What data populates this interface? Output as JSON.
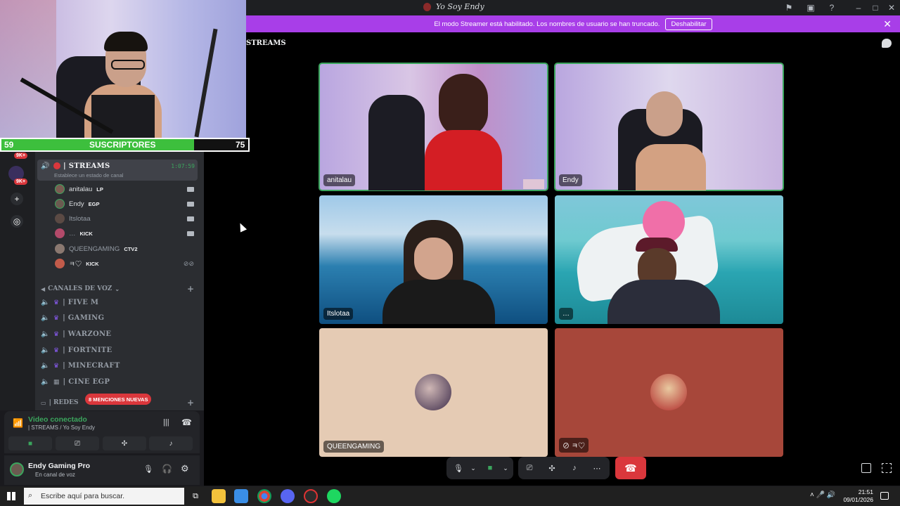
{
  "window": {
    "title": "Yo Soy Endy"
  },
  "banner": {
    "text": "El modo Streamer está habilitado. Los nombres de usuario se han truncado.",
    "button": "Deshabilitar"
  },
  "channel_header": "STREAMS",
  "overlay": {
    "sub_left": "59",
    "sub_label": "SUSCRIPTORES",
    "sub_right": "75",
    "sub_progress": 0.78
  },
  "rail": {
    "badge1": "9K+",
    "badge2": "9K+"
  },
  "sidebar": {
    "active_channel": {
      "name": "| STREAMS",
      "timer": "1:07:59",
      "status_prompt": "Establece un estado de canal"
    },
    "users": [
      {
        "name": "anitalau",
        "tag": "LP"
      },
      {
        "name": "Endy",
        "tag": "EGP"
      },
      {
        "name": "Itslotaa",
        "tag": ""
      },
      {
        "name": "…",
        "tag": "KICK"
      },
      {
        "name": "QUEENGAMING",
        "tag": "CTV2"
      },
      {
        "name": "ㅋ♡",
        "tag": "KICK"
      }
    ],
    "voice_category": "CANALES DE VOZ",
    "voice_channels": [
      "| FIVE M",
      "| GAMING",
      "| WARZONE",
      "| FORTNITE",
      "| MINECRAFT",
      "| CINE EGP"
    ],
    "redes_category": "| REDES",
    "mentions_badge": "8 MENCIONES NUEVAS"
  },
  "voice_panel": {
    "title": "Video conectado",
    "subtitle": "| STREAMS / Yo Soy Endy"
  },
  "user_panel": {
    "name": "Endy Gaming Pro",
    "status": "En canal de voz"
  },
  "tiles": [
    {
      "label": "anitalau"
    },
    {
      "label": "Endy"
    },
    {
      "label": "Itslotaa"
    },
    {
      "label": "…"
    },
    {
      "label": "QUEENGAMING"
    },
    {
      "label": "ㅋ♡"
    }
  ],
  "taskbar": {
    "search": "Escribe aquí para buscar.",
    "time": "21:51",
    "date": "09/01/2026"
  },
  "colors": {
    "accent": "#a83ee8",
    "speaking": "#3ba55d",
    "hangup": "#da373c"
  }
}
